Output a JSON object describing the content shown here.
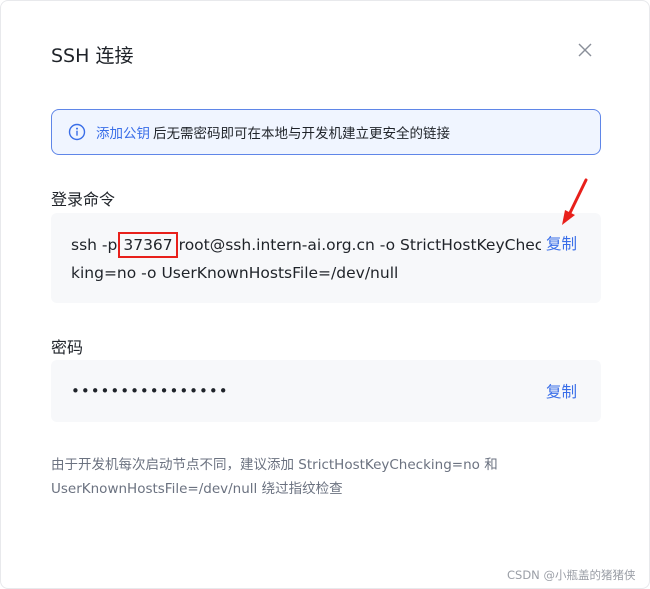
{
  "dialog": {
    "title": "SSH 连接",
    "close_icon": "close-icon"
  },
  "banner": {
    "icon": "info-icon",
    "link": "添加公钥",
    "text": "后无需密码即可在本地与开发机建立更安全的链接"
  },
  "login": {
    "label": "登录命令",
    "cmd_prefix": "ssh -p",
    "port": "37367",
    "cmd_suffix": "root@ssh.intern-ai.org.cn -o StrictHostKeyChec",
    "cmd_line2": "king=no -o UserKnownHostsFile=/dev/null",
    "copy_label": "复制"
  },
  "password": {
    "label": "密码",
    "masked": "••••••••••••••••",
    "copy_label": "复制"
  },
  "hint": {
    "line1": "由于开发机每次启动节点不同，建议添加 StrictHostKeyChecking=no 和",
    "line2": "UserKnownHostsFile=/dev/null 绕过指纹检查"
  },
  "annotation": {
    "highlight_color": "#e8201b",
    "arrow_icon": "red-arrow-icon"
  },
  "watermark": "CSDN @小瓶盖的猪猪侠",
  "colors": {
    "accent": "#3a6ee8",
    "banner_bg": "#f0f5ff",
    "field_bg": "#f7f8fa",
    "annotation_red": "#e8201b"
  }
}
